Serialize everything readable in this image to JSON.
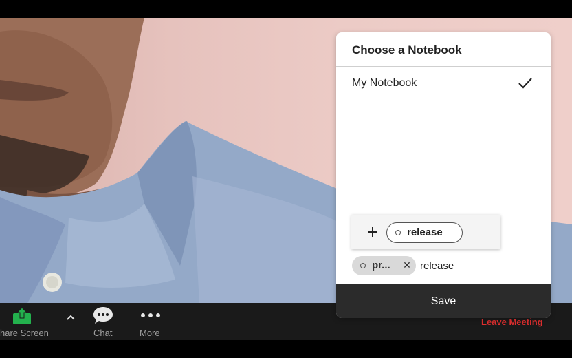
{
  "notebook_dialog": {
    "title": "Choose a Notebook",
    "notebooks": [
      {
        "name": "My Notebook",
        "selected": true
      }
    ],
    "tag_suggestion": "release",
    "tags": [
      {
        "label": "pr..."
      }
    ],
    "tag_input_value": "release",
    "save_label": "Save"
  },
  "toolbar": {
    "share_screen_label": "hare Screen",
    "chat_label": "Chat",
    "more_label": "More",
    "leave_label": "Leave Meeting"
  },
  "colors": {
    "share_green": "#23b14d",
    "leave_red": "#e02f2f",
    "toolbar_bg": "#1a1a1a",
    "save_bg": "#2b2b2b"
  },
  "icons": {
    "share": "share-screen-icon",
    "caret": "chevron-up-icon",
    "chat": "chat-bubble-icon",
    "more": "more-dots-icon",
    "check": "checkmark-icon",
    "plus": "plus-icon",
    "close": "close-icon"
  }
}
